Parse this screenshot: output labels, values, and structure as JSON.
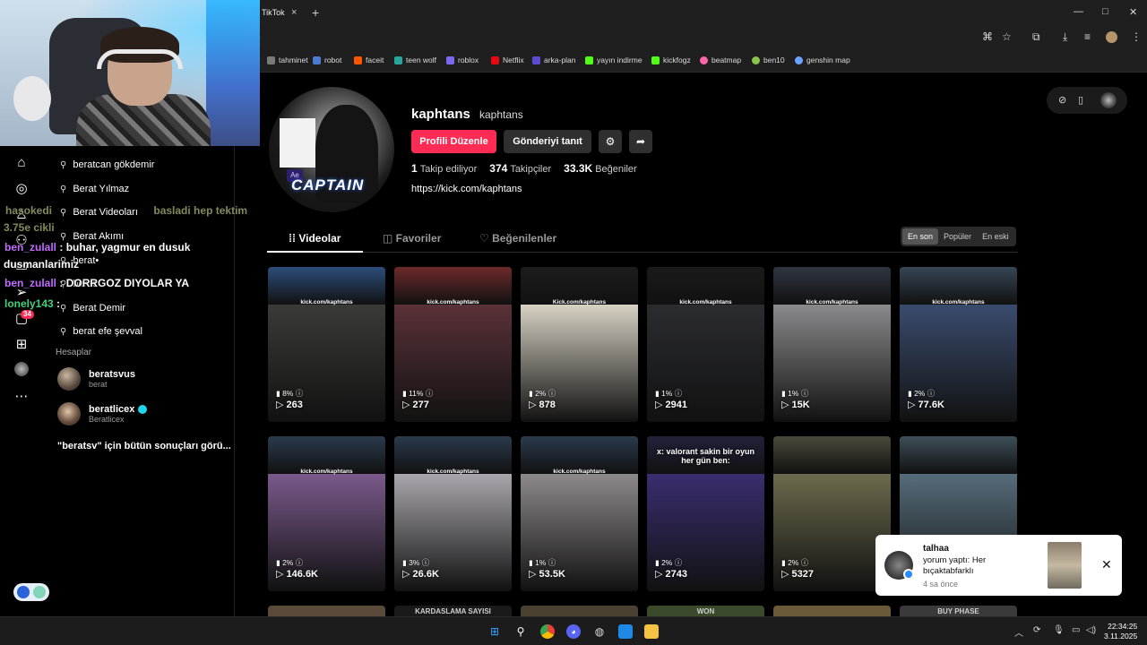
{
  "browser": {
    "tab_title": "TikTok",
    "tab_close": "×",
    "new_tab": "+",
    "window_controls": [
      "—",
      "□",
      "✕"
    ],
    "bookmarks": [
      {
        "label": "tahminet",
        "color": "#7a7a7a"
      },
      {
        "label": "robot",
        "color": "#4a7bd0"
      },
      {
        "label": "faceit",
        "color": "#ff5500"
      },
      {
        "label": "teen wolf",
        "color": "#26a69a"
      },
      {
        "label": "roblox",
        "color": "#7b68ee"
      },
      {
        "label": "Netflix",
        "color": "#e50914"
      },
      {
        "label": "arka-plan",
        "color": "#5c4bd1"
      },
      {
        "label": "yayın indirme",
        "color": "#53fc18"
      },
      {
        "label": "kickfogz",
        "color": "#53fc18"
      },
      {
        "label": "beatmap",
        "color": "#ff66aa"
      },
      {
        "label": "ben10",
        "color": "#8bc34a"
      },
      {
        "label": "genshin map",
        "color": "#6aa2ff"
      }
    ]
  },
  "search_panel": {
    "suggestions": [
      "beratcan gökdemir",
      "Berat Yılmaz",
      "Berat Videoları",
      "Berat Akımı",
      "berat•",
      "berat",
      "Berat Demir",
      "berat efe şevval"
    ],
    "accounts_label": "Hesaplar",
    "accounts": [
      {
        "name": "beratsvus",
        "sub": "berat",
        "verified": false
      },
      {
        "name": "beratlicex",
        "sub": "Beratlicex",
        "verified": true
      }
    ],
    "all_results": "\"beratsv\" için bütün sonuçları görü...",
    "inbox_badge": "34"
  },
  "chat": [
    {
      "user": "hasokedi",
      "text": "basladi hep tektim",
      "style": "dim"
    },
    {
      "user": "3.75e",
      "text": "cikli",
      "style": "dim"
    },
    {
      "user": "ben_zulall",
      "text": ": buhar, yagmur en dusuk",
      "style": "white"
    },
    {
      "user": "",
      "text": "dusmanlarimiz",
      "style": "white"
    },
    {
      "user": "ben_zulall",
      "text": ": DORRGOZ DIYOLAR YA",
      "style": "white"
    },
    {
      "user": "lonely143",
      "text": ":",
      "style": "green"
    }
  ],
  "profile": {
    "username": "kaphtans",
    "nickname": "kaphtans",
    "edit_button": "Profili Düzenle",
    "promote_button": "Gönderiyi tanıt",
    "following_count": "1",
    "following_label": "Takip ediliyor",
    "followers_count": "374",
    "followers_label": "Takipçiler",
    "likes_count": "33.3K",
    "likes_label": "Beğeniler",
    "link": "https://kick.com/kaphtans",
    "avatar_text": "CAPTAIN",
    "avatar_badge": "Ae"
  },
  "tabs": [
    {
      "label": "Videolar",
      "icon": "grid-icon"
    },
    {
      "label": "Favoriler",
      "icon": "bookmark-icon"
    },
    {
      "label": "Beğenilenler",
      "icon": "heart-icon"
    }
  ],
  "sort": [
    "En son",
    "Popüler",
    "En eski"
  ],
  "videos": [
    {
      "pct": "8%",
      "views": "263",
      "kick": "kick.com/kaphtans",
      "cam": "#2c4e7a",
      "scene": "#3a3a38",
      "overlay": ""
    },
    {
      "pct": "11%",
      "views": "277",
      "kick": "kick.com/kaphtans",
      "cam": "#6d2a2a",
      "scene": "#5a3238",
      "overlay": ""
    },
    {
      "pct": "2%",
      "views": "878",
      "kick": "Kick.com/kaphtans",
      "cam": "#1c1c1c",
      "scene": "#d7d2c3",
      "overlay": ""
    },
    {
      "pct": "1%",
      "views": "2941",
      "kick": "kick.com/kaphtans",
      "cam": "#1a1a1a",
      "scene": "#2b2c30",
      "overlay": ""
    },
    {
      "pct": "1%",
      "views": "15K",
      "kick": "kick.com/kaphtans",
      "cam": "#2f3540",
      "scene": "#8a8a8c",
      "overlay": ""
    },
    {
      "pct": "2%",
      "views": "77.6K",
      "kick": "kick.com/kaphtans",
      "cam": "#364656",
      "scene": "#3a4b6d",
      "overlay": ""
    },
    {
      "pct": "2%",
      "views": "146.6K",
      "kick": "kick.com/kaphtans",
      "cam": "#2b3b4d",
      "scene": "#7a5a8c",
      "overlay": ""
    },
    {
      "pct": "3%",
      "views": "26.6K",
      "kick": "kick.com/kaphtans",
      "cam": "#2b3b4d",
      "scene": "#a9a7ad",
      "overlay": ""
    },
    {
      "pct": "1%",
      "views": "53.5K",
      "kick": "kick.com/kaphtans",
      "cam": "#2b3b4d",
      "scene": "#8e8a8c",
      "overlay": ""
    },
    {
      "pct": "2%",
      "views": "2743",
      "kick": "",
      "cam": "#23213a",
      "scene": "#3a2e70",
      "overlay": "x: valorant sakin bir oyun her gün ben:"
    },
    {
      "pct": "2%",
      "views": "5327",
      "kick": "",
      "cam": "#4a4a3a",
      "scene": "#6c6a4c",
      "overlay": ""
    },
    {
      "pct": "",
      "views": "",
      "kick": "",
      "cam": "#3d4e58",
      "scene": "#566c7a",
      "overlay": ""
    }
  ],
  "peek_row": [
    {
      "label": "",
      "color": "#5a4a3a"
    },
    {
      "label": "KARDASLAMA SAYISI",
      "color": "#1a1a1a"
    },
    {
      "label": "",
      "color": "#4a4030"
    },
    {
      "label": "WON",
      "color": "#3a4a2a"
    },
    {
      "label": "",
      "color": "#6a5a3a"
    },
    {
      "label": "BUY PHASE",
      "color": "#3a3a3a"
    }
  ],
  "notification": {
    "name": "talhaa",
    "message": "yorum yaptı: Her bıçaktabfarklı",
    "time": "4 sa önce",
    "close": "✕"
  },
  "taskbar": {
    "time": "22:34:25",
    "date": "3.11.2025"
  },
  "colors": {
    "accent": "#fe2c55",
    "verified": "#20d5ec"
  }
}
